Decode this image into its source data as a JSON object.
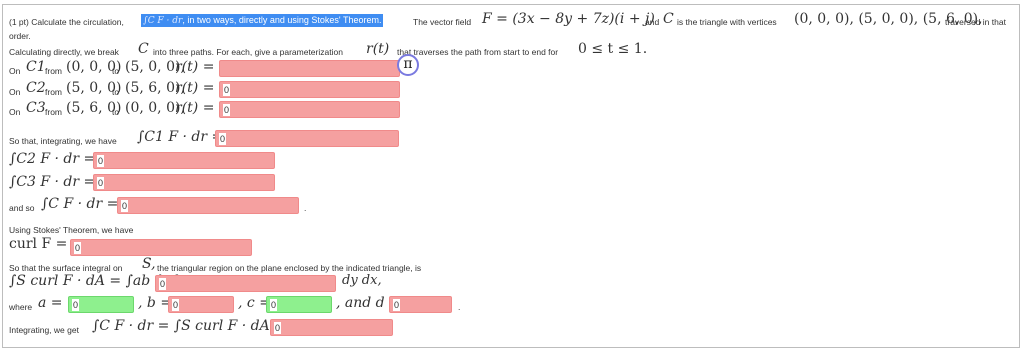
{
  "problem": {
    "points_prefix": "(1 pt) Calculate the circulation,",
    "highlight_math": "∫C F · dr",
    "highlight_text": ", in two ways, directly and using Stokes' Theorem.",
    "field_intro": "The vector field",
    "field_formula": "F = (3x − 8y + 7z)(i + j)",
    "and_text": "and",
    "curve_sym": "C",
    "triangle_text": "is the triangle with vertices",
    "vertices": "(0, 0, 0), (5, 0, 0), (5, 6, 0),",
    "traversed": "traversed in that",
    "order": "order."
  },
  "direct": {
    "intro_a": "Calculating directly, we break",
    "intro_b": "into three paths. For each, give a parameterization",
    "intro_c": "that traverses the path from start to end for",
    "t_range": "0 ≤ t ≤ 1.",
    "r_of_t": "r(t)",
    "paths": [
      {
        "on": "On",
        "curve": "C1",
        "from": "from",
        "start": "(0, 0, 0)",
        "to": "to",
        "end": "(5, 0, 0),",
        "rt": "r(t) =",
        "value": ""
      },
      {
        "on": "On",
        "curve": "C2",
        "from": "from",
        "start": "(5, 0, 0)",
        "to": "to",
        "end": "(5, 6, 0),",
        "rt": "r(t) =",
        "value": "0"
      },
      {
        "on": "On",
        "curve": "C3",
        "from": "from",
        "start": "(5, 6, 0)",
        "to": "to",
        "end": "(0, 0, 0),",
        "rt": "r(t) =",
        "value": "0"
      }
    ],
    "integrating_text": "So that, integrating, we have",
    "int_c1": "∫C1 F · dr =",
    "int_c1_value": "0",
    "int_c2": "∫C2 F · dr =",
    "int_c2_value": "0",
    "int_c3": "∫C3 F · dr =",
    "int_c3_value": "0",
    "and_so": "and so",
    "int_c": "∫C F · dr =",
    "int_c_value": "0",
    "period": "."
  },
  "stokes": {
    "heading": "Using Stokes' Theorem, we have",
    "curl_label": "curl F =",
    "curl_value": "0",
    "surface_text_a": "So that the surface integral on",
    "surface_sym": "S,",
    "surface_text_b": "the triangular region on the plane enclosed by the indicated triangle, is",
    "surface_integral": "∫S curl F · dA = ∫ab ∫cd",
    "integrand_value": "0",
    "dydx": "dy dx,",
    "where": "where",
    "a_label": "a =",
    "a_value": "0",
    "b_label": ", b =",
    "b_value": "0",
    "c_label": ", c =",
    "c_value": "0",
    "d_label": ", and d =",
    "d_value": "0",
    "end_period": ".",
    "integrating_get": "Integrating, we get",
    "final_formula": "∫C F · dr = ∫S curl F · dA =",
    "final_value": "0"
  },
  "pi_button": "π"
}
